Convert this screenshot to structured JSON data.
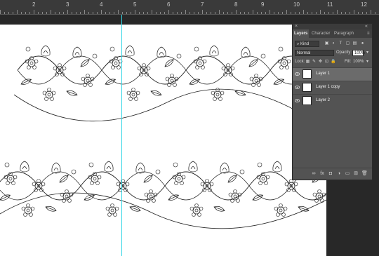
{
  "ruler": {
    "numbers": [
      "2",
      "3",
      "4",
      "5",
      "6",
      "7",
      "8",
      "9",
      "10",
      "11",
      "12"
    ]
  },
  "panel": {
    "collapse": "«",
    "close": "×",
    "menu": "≡",
    "tabs": [
      "Layers",
      "Character",
      "Paragraph"
    ],
    "filter": {
      "kind": "Kind"
    },
    "blend_mode": "Normal",
    "opacity_label": "Opacity:",
    "opacity_value": "100%",
    "lock_label": "Lock:",
    "fill_label": "Fill:",
    "fill_value": "100%",
    "layers": [
      {
        "name": "Layer 1",
        "selected": true
      },
      {
        "name": "Layer 1 copy",
        "selected": false
      },
      {
        "name": "Layer 2",
        "selected": false
      }
    ]
  },
  "guide_color": "#33d6e6",
  "icons": [
    "link-icon",
    "fx-icon",
    "mask-icon",
    "adjustment-icon",
    "folder-icon",
    "new-layer-icon",
    "trash-icon"
  ]
}
